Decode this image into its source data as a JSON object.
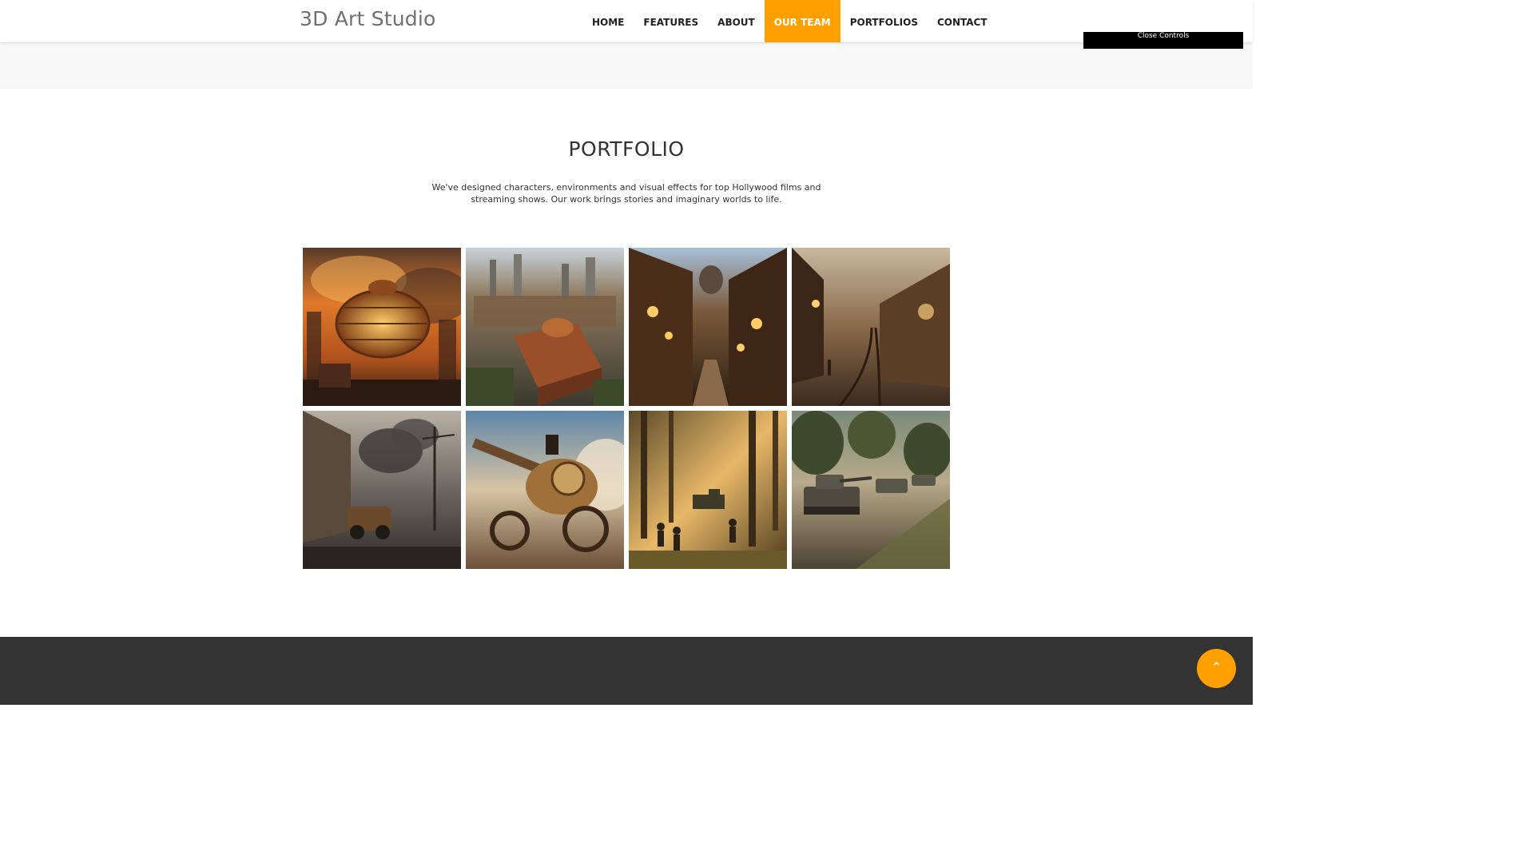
{
  "header": {
    "brand": "3D Art Studio",
    "nav": [
      {
        "label": "HOME"
      },
      {
        "label": "FEATURES"
      },
      {
        "label": "ABOUT"
      },
      {
        "label": "OUR TEAM",
        "active": true
      },
      {
        "label": "PORTFOLIOS"
      },
      {
        "label": "CONTACT"
      }
    ]
  },
  "overlay": {
    "close_controls": "Close Controls"
  },
  "portfolio": {
    "title": "PORTFOLIO",
    "description": "We've designed characters, environments and visual effects for top Hollywood films and streaming shows. Our work brings stories and imaginary worlds to life."
  },
  "to_top": {
    "icon": "chevron-up-icon",
    "glyph": "⌃"
  },
  "colors": {
    "accent": "#ffa000",
    "footer": "#333333",
    "band": "#f8f8f8"
  }
}
